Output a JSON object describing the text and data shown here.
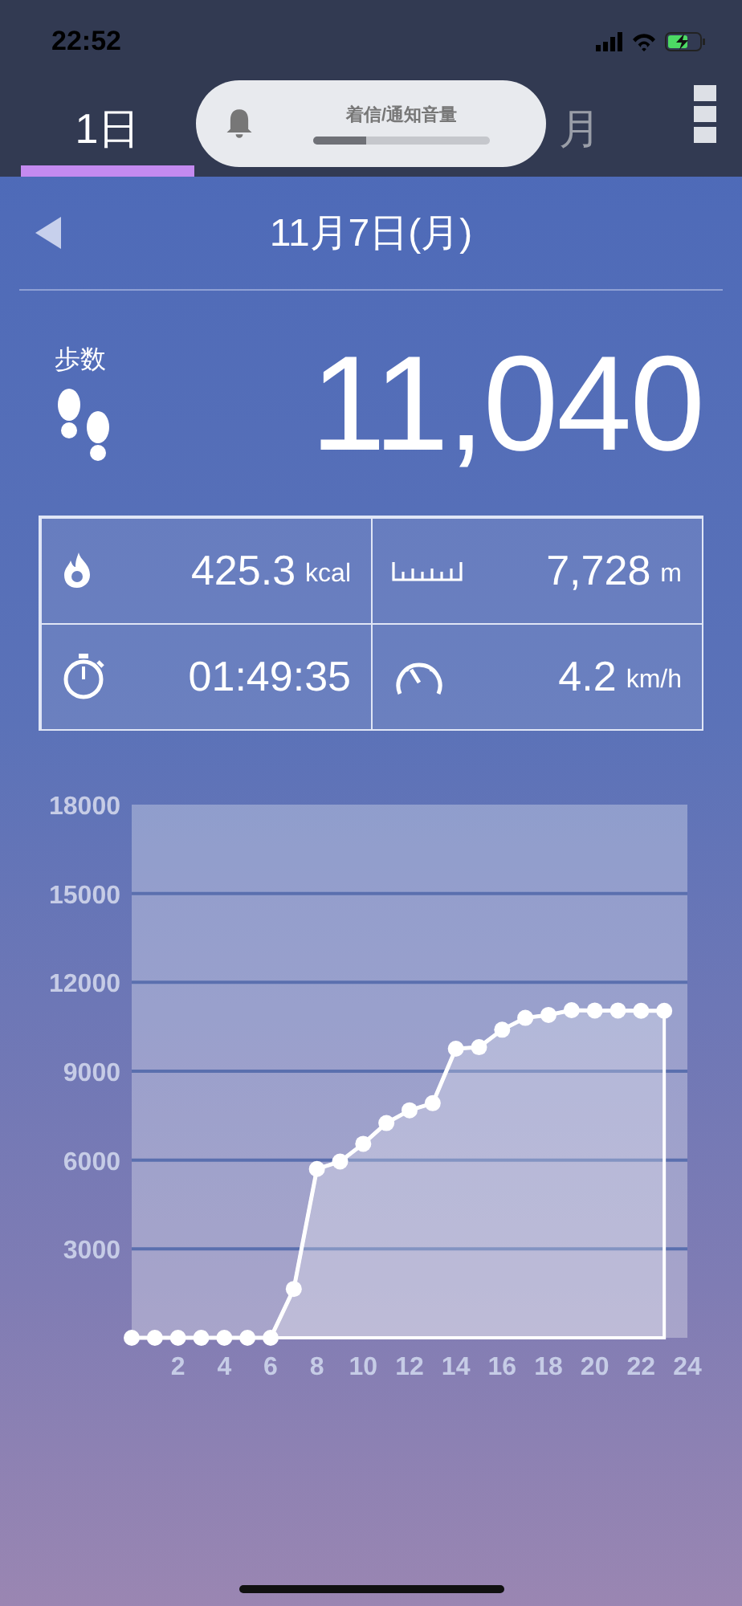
{
  "status_bar": {
    "time": "22:52"
  },
  "tabs": [
    {
      "label": "1日",
      "selected": true
    },
    {
      "label": "月",
      "selected": false
    }
  ],
  "volume_hud": {
    "title": "着信/通知音量",
    "level": 0.3
  },
  "date_nav": {
    "date": "11月7日(月)"
  },
  "steps": {
    "label": "歩数",
    "value": "11,040"
  },
  "stats": [
    {
      "kind": "calories",
      "value": "425.3",
      "unit": "kcal"
    },
    {
      "kind": "distance",
      "value": "7,728",
      "unit": "m"
    },
    {
      "kind": "duration",
      "value": "01:49:35"
    },
    {
      "kind": "speed",
      "value": "4.2",
      "unit": "km/h"
    }
  ],
  "chart_data": {
    "type": "area",
    "x": [
      0,
      1,
      2,
      3,
      4,
      5,
      6,
      7,
      8,
      9,
      10,
      11,
      12,
      13,
      14,
      15,
      16,
      17,
      18,
      19,
      20,
      21,
      22,
      23
    ],
    "grid": true,
    "series": [
      {
        "color": "#ffffff",
        "values": [
          0,
          0,
          0,
          0,
          0,
          0,
          0,
          1650,
          5700,
          5950,
          6550,
          7250,
          7680,
          7920,
          9760,
          9810,
          10400,
          10800,
          10900,
          11060,
          11050,
          11050,
          11040,
          11040
        ]
      }
    ],
    "xlim": [
      0,
      24
    ],
    "ylim": [
      0,
      18000
    ],
    "xticks": [
      2,
      4,
      6,
      8,
      10,
      12,
      14,
      16,
      18,
      20,
      22,
      24
    ],
    "yticks": [
      3000,
      6000,
      9000,
      12000,
      15000,
      18000
    ]
  }
}
